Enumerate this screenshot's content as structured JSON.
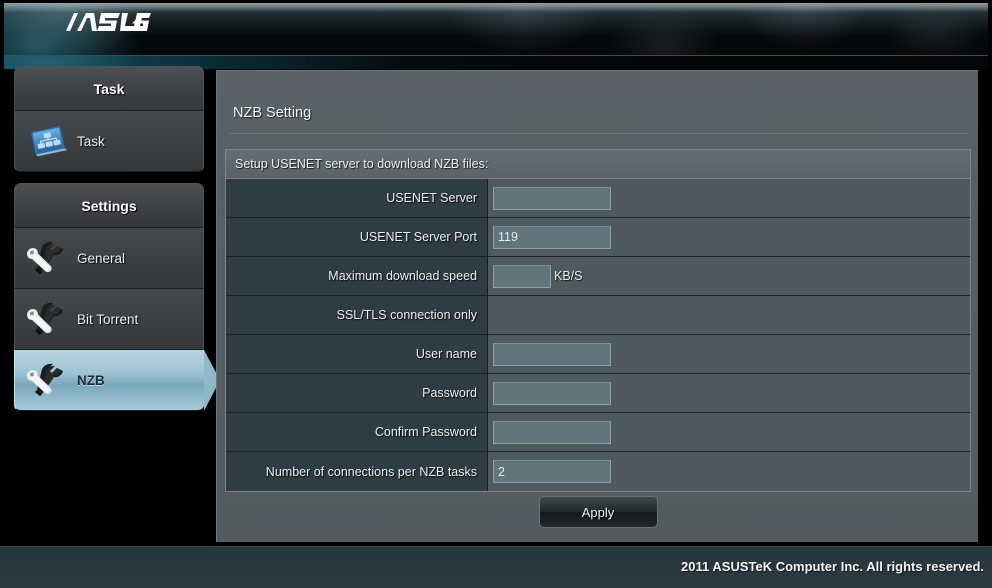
{
  "header": {
    "brand": "ASUS",
    "logo_icon": "asus-logo"
  },
  "sidebar": {
    "sections": [
      {
        "title": "Task",
        "items": [
          {
            "label": "Task",
            "icon": "network-task-icon",
            "active": false
          }
        ]
      },
      {
        "title": "Settings",
        "items": [
          {
            "label": "General",
            "icon": "tools-icon",
            "active": false
          },
          {
            "label": "Bit Torrent",
            "icon": "tools-icon",
            "active": false
          },
          {
            "label": "NZB",
            "icon": "tools-icon",
            "active": true
          }
        ]
      }
    ]
  },
  "main": {
    "title": "NZB Setting",
    "table_caption": "Setup USENET server to download NZB files:",
    "rows": [
      {
        "label": "USENET Server",
        "value": "",
        "field": "wide",
        "unit": ""
      },
      {
        "label": "USENET Server Port",
        "value": "119",
        "field": "wide",
        "unit": ""
      },
      {
        "label": "Maximum download speed",
        "value": "",
        "field": "small",
        "unit": "KB/S"
      },
      {
        "label": "SSL/TLS connection only",
        "value": "",
        "field": "none",
        "unit": ""
      },
      {
        "label": "User name",
        "value": "",
        "field": "wide",
        "unit": ""
      },
      {
        "label": "Password",
        "value": "",
        "field": "wide",
        "unit": ""
      },
      {
        "label": "Confirm Password",
        "value": "",
        "field": "wide",
        "unit": ""
      },
      {
        "label": "Number of connections per NZB tasks",
        "value": "2",
        "field": "wide",
        "unit": ""
      }
    ],
    "apply_label": "Apply"
  },
  "footer": {
    "copyright": "2011 ASUSTeK Computer Inc. All rights reserved."
  },
  "colors": {
    "accent_active": "#9ec4d4",
    "panel_bg": "#575e63",
    "label_bg": "#2e3c43",
    "field_bg": "#61757d",
    "footer_bg": "#2c3a42"
  }
}
